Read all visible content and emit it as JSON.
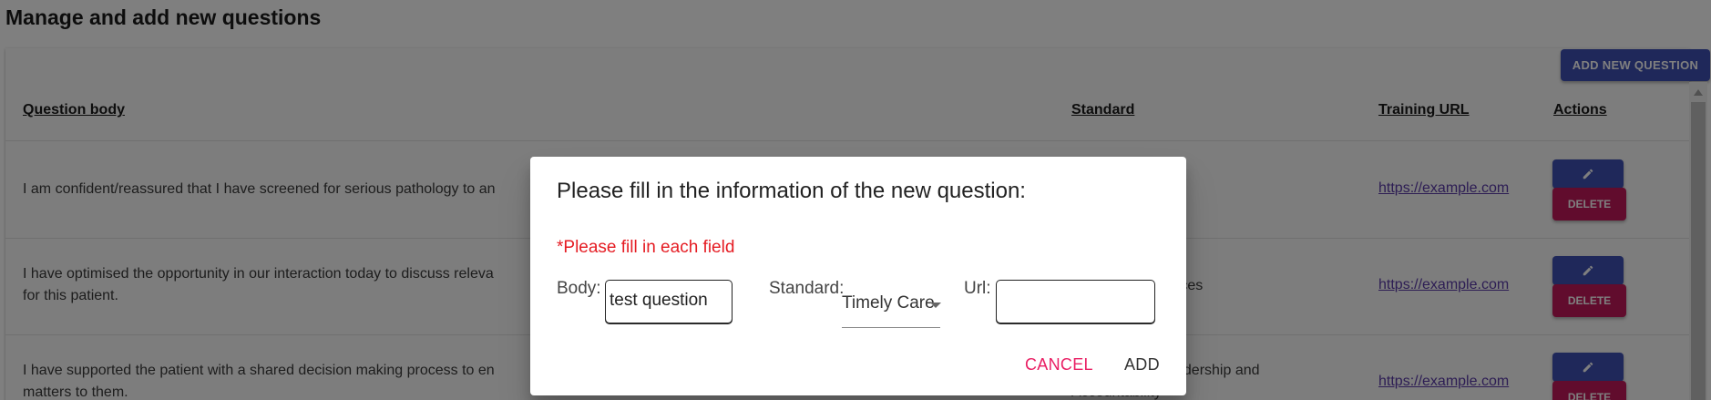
{
  "page": {
    "title": "Manage and add new questions"
  },
  "toolbar": {
    "add_label": "ADD NEW QUESTION"
  },
  "table": {
    "headers": {
      "body": "Question body",
      "standard": "Standard",
      "url": "Training URL",
      "actions": "Actions"
    },
    "rows": [
      {
        "body_line1": "I am confident/reassured that I have screened for serious pathology to an",
        "body_line2": "",
        "standard_line1": "",
        "standard_line2": "",
        "url": "https://example.com",
        "delete_label": "DELETE"
      },
      {
        "body_line1": "I have optimised the opportunity in our interaction today to discuss releva",
        "body_line2": "for this patient.",
        "standard_line1": "rces",
        "standard_line2": "",
        "url": "https://example.com",
        "delete_label": "DELETE"
      },
      {
        "body_line1": "I have supported the patient with a shared decision making process to en",
        "body_line2": "matters to them.",
        "standard_line1": "adership and",
        "standard_line2": "Accountability",
        "url": "https://example.com",
        "delete_label": "DELETE"
      }
    ]
  },
  "dialog": {
    "title": "Please fill in the information of the new question:",
    "warning": "*Please fill in each field",
    "body_label": "Body:",
    "body_value": "test question",
    "standard_label": "Standard:",
    "standard_value": "Timely Care",
    "url_label": "Url:",
    "url_value": "",
    "cancel_label": "CANCEL",
    "add_label": "ADD"
  },
  "colors": {
    "primary": "#3f51b5",
    "danger": "#c2185b",
    "cancel_text": "#e91e63",
    "warning_text": "#e51c23"
  },
  "icons": {
    "edit": "pencil-icon",
    "scroll_up": "arrow-up-icon",
    "dropdown": "caret-down-icon"
  }
}
